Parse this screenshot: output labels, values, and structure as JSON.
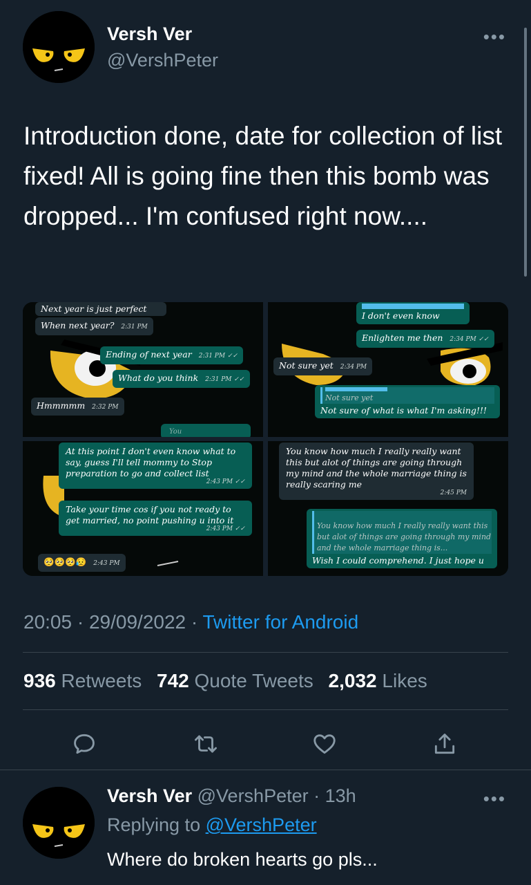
{
  "tweet": {
    "author_name": "Versh Ver",
    "author_handle": "@VershPeter",
    "more_icon": "more-horizontal-icon",
    "text": "Introduction done, date for collection of list fixed! All is going fine then this bomb was dropped... I'm confused right now....",
    "time": "20:05",
    "date": "29/09/2022",
    "separator": "·",
    "source": "Twitter for Android",
    "stats": {
      "retweets_count": "936",
      "retweets_label": "Retweets",
      "quotes_count": "742",
      "quotes_label": "Quote Tweets",
      "likes_count": "2,032",
      "likes_label": "Likes"
    },
    "actions": [
      "reply-icon",
      "retweet-icon",
      "like-icon",
      "share-icon"
    ]
  },
  "media": {
    "shot1": {
      "m1": "Next year is just perfect",
      "m2": "When next year?",
      "m2_time": "2:31 PM",
      "m3": "Ending of next year",
      "m3_time": "2:31 PM",
      "m4": "What do you think",
      "m4_time": "2:31 PM",
      "m5": "Hmmmmm",
      "m5_time": "2:32 PM",
      "m6": "You"
    },
    "shot2": {
      "m1": "I don't even know",
      "m2": "Enlighten me then",
      "m2_time": "2:34 PM",
      "m3": "Not sure yet",
      "m3_time": "2:34 PM",
      "m4_quote": "Not sure yet",
      "m4": "Not sure of what is what I'm asking!!!"
    },
    "shot3": {
      "m1": "At this point I don't even know what to say, guess I'll tell mommy to Stop preparation to go and collect list",
      "m1_time": "2:43 PM",
      "m2": "Take your time cos if you not ready to get married, no point pushing u into it",
      "m2_time": "2:43 PM",
      "m3": "🥺🥺🥺😥",
      "m3_time": "2:43 PM"
    },
    "shot4": {
      "m1": "You know how much I really really want this but alot of things are going through my mind and the whole marriage thing is really scaring me",
      "m1_time": "2:45 PM",
      "m2_quote": "You know how much I really really want this but alot of things are going through my mind and the whole marriage thing is...",
      "m2": "Wish I could comprehend. I just hope u"
    }
  },
  "reply": {
    "author_name": "Versh Ver",
    "author_handle": "@VershPeter",
    "age": "13h",
    "replying_to_label": "Replying to",
    "replying_to_handle": "@VershPeter",
    "text": "Where do broken hearts go pls..."
  },
  "colors": {
    "background": "#15202b",
    "text_secondary": "#8899a6",
    "link": "#1d9bf0",
    "divider": "#38444d"
  }
}
